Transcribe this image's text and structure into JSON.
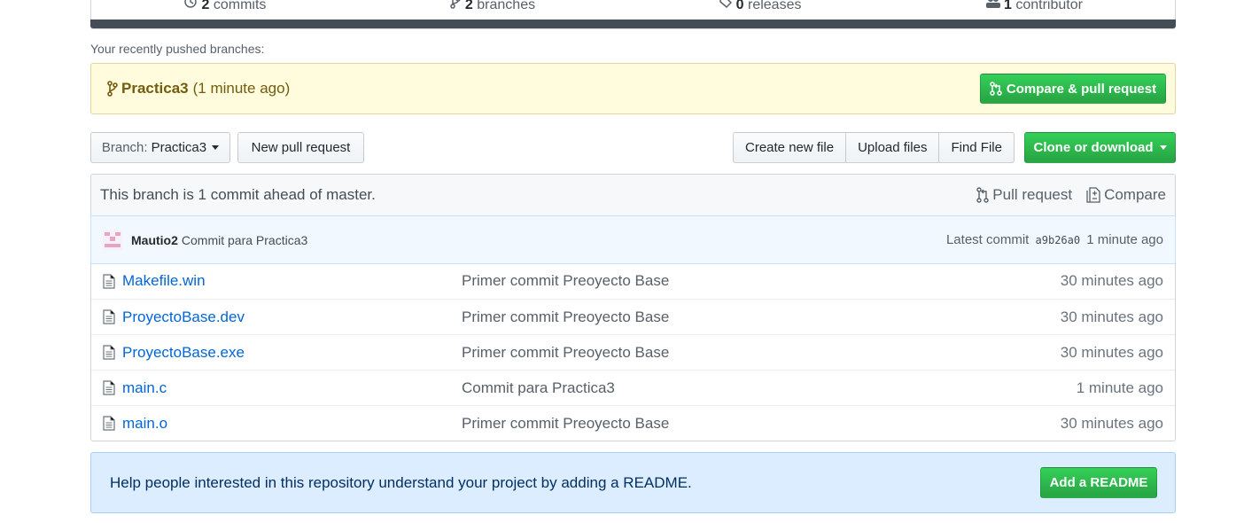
{
  "summary": {
    "commits_count": "2",
    "commits_label": "commits",
    "branches_count": "2",
    "branches_label": "branches",
    "releases_count": "0",
    "releases_label": "releases",
    "contributors_count": "1",
    "contributors_label": "contributor"
  },
  "recent": {
    "label": "Your recently pushed branches:",
    "branch_name": "Practica3",
    "ago": "(1 minute ago)",
    "compare_label": "Compare & pull request"
  },
  "toolbar": {
    "branch_prefix": "Branch:",
    "branch_value": "Practica3",
    "new_pr_label": "New pull request",
    "create_file_label": "Create new file",
    "upload_label": "Upload files",
    "find_label": "Find File",
    "clone_label": "Clone or download"
  },
  "ahead": {
    "text": "This branch is 1 commit ahead of master.",
    "pull_request_label": "Pull request",
    "compare_label": "Compare"
  },
  "latest_commit": {
    "author": "Mautio2",
    "message": "Commit para Practica3",
    "prefix": "Latest commit",
    "sha": "a9b26a0",
    "ago": "1 minute ago"
  },
  "files": [
    {
      "name": "Makefile.win",
      "message": "Primer commit Preoyecto Base",
      "age": "30 minutes ago"
    },
    {
      "name": "ProyectoBase.dev",
      "message": "Primer commit Preoyecto Base",
      "age": "30 minutes ago"
    },
    {
      "name": "ProyectoBase.exe",
      "message": "Primer commit Preoyecto Base",
      "age": "30 minutes ago"
    },
    {
      "name": "main.c",
      "message": "Commit para Practica3",
      "age": "1 minute ago"
    },
    {
      "name": "main.o",
      "message": "Primer commit Preoyecto Base",
      "age": "30 minutes ago"
    }
  ],
  "readme": {
    "text": "Help people interested in this repository understand your project by adding a README.",
    "button_label": "Add a README"
  },
  "colors": {
    "green": "#28a745",
    "link_blue": "#0366d6",
    "recent_bg": "#fffbdd",
    "readme_bg": "#dbedff"
  }
}
